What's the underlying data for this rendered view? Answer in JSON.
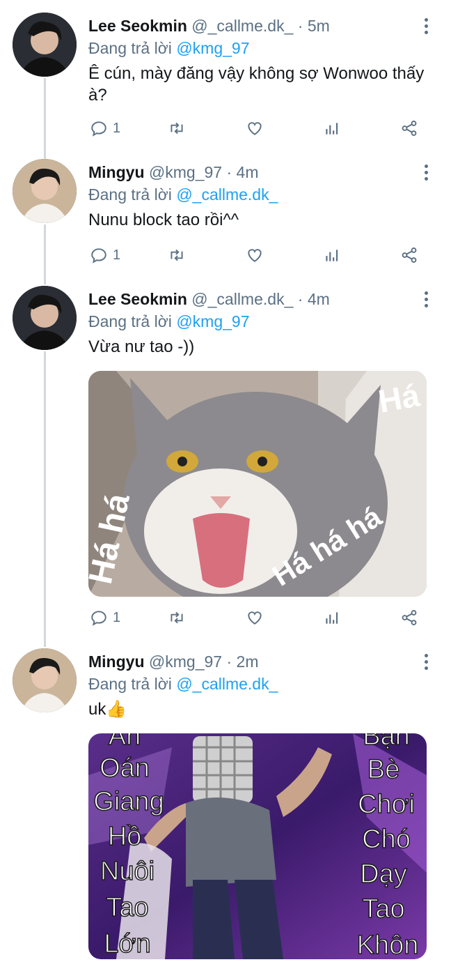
{
  "tweets": [
    {
      "name": "Lee Seokmin",
      "handle": "@_callme.dk_",
      "time_sep": " · ",
      "time": "5m",
      "reply_prefix": "Đang trả lời",
      "reply_handle": "@kmg_97",
      "text": "Ê cún, mày đăng vậy không sợ Wonwoo thấy à?",
      "reply_count": "1"
    },
    {
      "name": "Mingyu",
      "handle": "@kmg_97",
      "time_sep": " · ",
      "time": "4m",
      "reply_prefix": "Đang trả lời",
      "reply_handle": "@_callme.dk_",
      "text": "Nunu block tao rồi^^",
      "reply_count": "1"
    },
    {
      "name": "Lee Seokmin",
      "handle": "@_callme.dk_",
      "time_sep": " · ",
      "time": "4m",
      "reply_prefix": "Đang trả lời",
      "reply_handle": "@kmg_97",
      "text": "Vừa nư tao -))",
      "reply_count": "1",
      "media_text": [
        "Há há",
        "Há há há",
        "Há há"
      ]
    },
    {
      "name": "Mingyu",
      "handle": "@kmg_97",
      "time_sep": " · ",
      "time": "2m",
      "reply_prefix": "Đang trả lời",
      "reply_handle": "@_callme.dk_",
      "text": "uk",
      "emoji": "👍",
      "media_left_words": [
        "Ăn",
        "Oán",
        "Giang",
        "Hồ",
        "Nuôi",
        "Tao",
        "Lớn"
      ],
      "media_right_words": [
        "Bạn",
        "Bè",
        "Chơi",
        "Chó",
        "Dạy",
        "Tao",
        "Khôn"
      ]
    }
  ],
  "icons": [
    "reply-icon",
    "retweet-icon",
    "like-icon",
    "analytics-icon",
    "share-icon",
    "more-icon"
  ],
  "colors": {
    "link": "#1da1f2",
    "secondary": "#5b7083",
    "thread": "#cfd9de"
  }
}
